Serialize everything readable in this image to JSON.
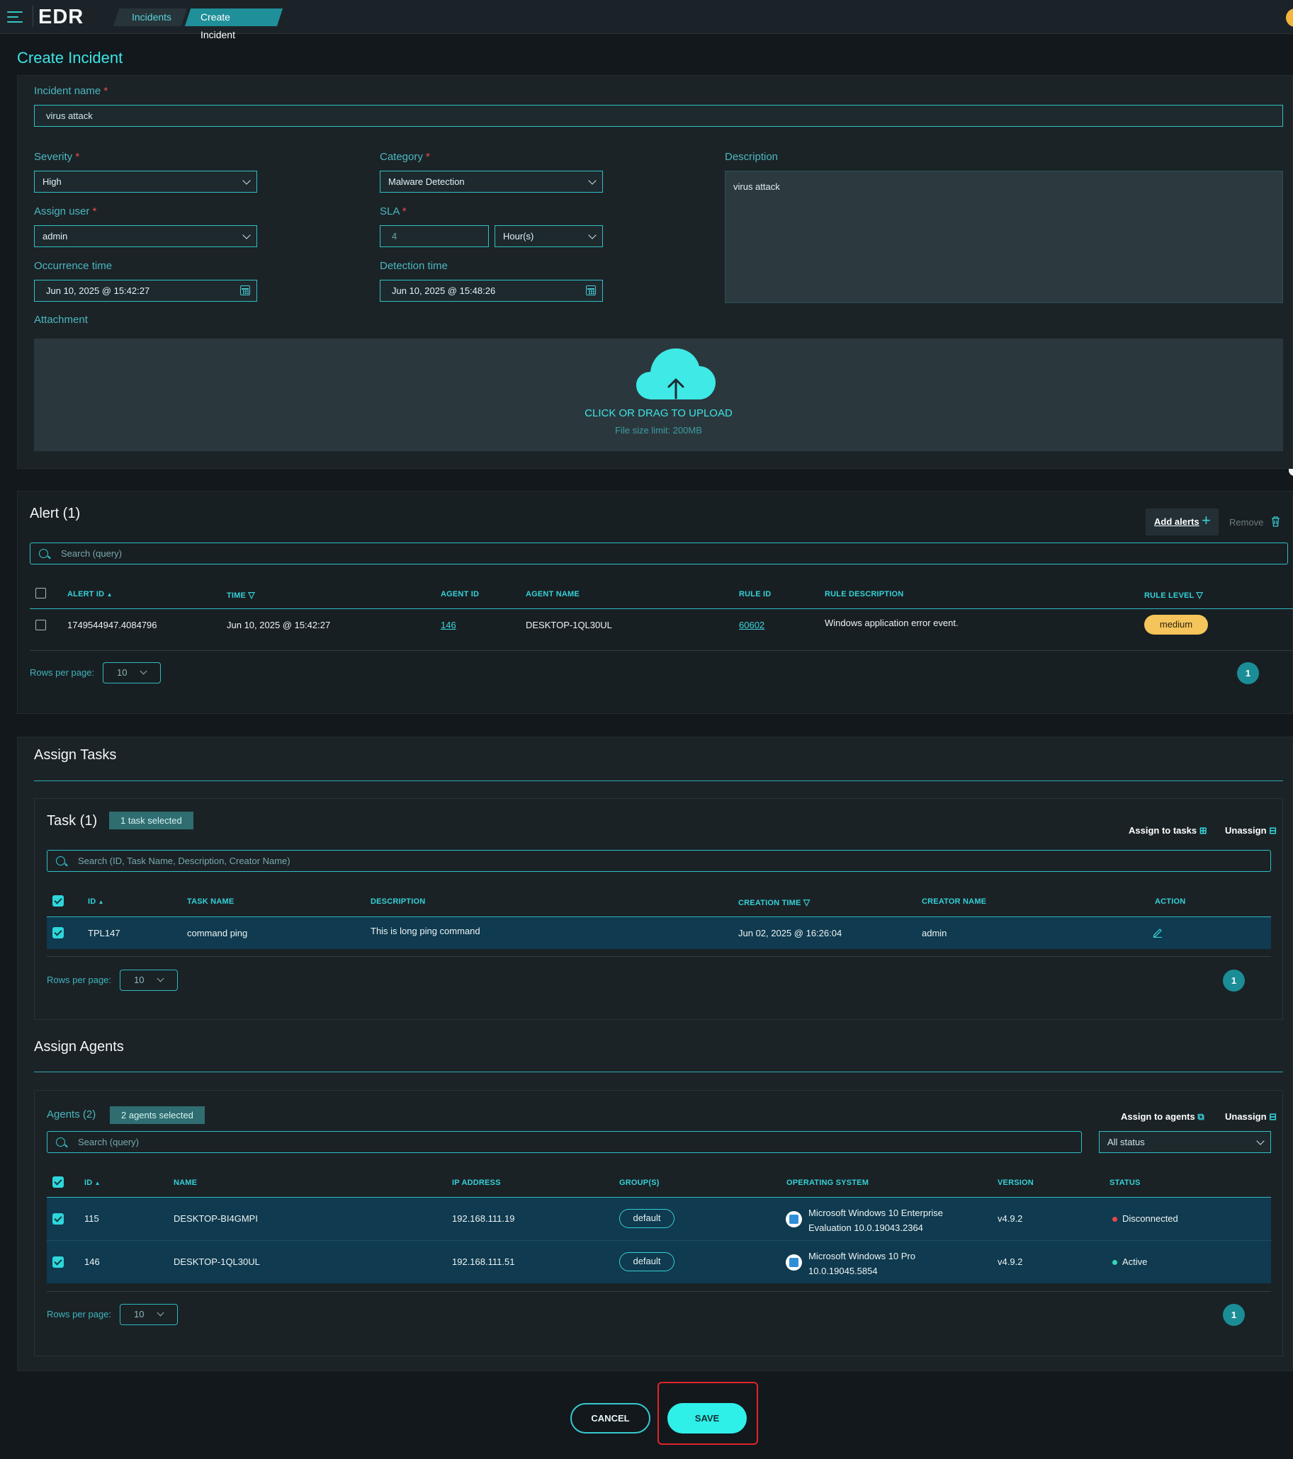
{
  "app": {
    "logo": "EDR"
  },
  "breadcrumb": {
    "items": [
      "Incidents",
      "Create Incident"
    ]
  },
  "page_title": "Create Incident",
  "form": {
    "incident_name": {
      "label": "Incident name",
      "value": "virus attack"
    },
    "severity": {
      "label": "Severity",
      "value": "High"
    },
    "category": {
      "label": "Category",
      "value": "Malware Detection"
    },
    "description": {
      "label": "Description",
      "value": "virus attack"
    },
    "assign_user": {
      "label": "Assign user",
      "value": "admin"
    },
    "sla": {
      "label": "SLA",
      "value": "4",
      "unit": "Hour(s)"
    },
    "occurrence_time": {
      "label": "Occurrence time",
      "value": "Jun 10, 2025 @ 15:42:27"
    },
    "detection_time": {
      "label": "Detection time",
      "value": "Jun 10, 2025 @ 15:48:26"
    },
    "attachment": {
      "label": "Attachment",
      "upload_text": "CLICK OR DRAG TO UPLOAD",
      "limit_text": "File size limit: 200MB"
    },
    "required_mark": "*"
  },
  "alerts": {
    "title": "Alert (1)",
    "add_label": "Add alerts",
    "remove_label": "Remove",
    "search_placeholder": "Search (query)",
    "columns": [
      "ALERT ID",
      "TIME",
      "AGENT ID",
      "AGENT NAME",
      "RULE ID",
      "RULE DESCRIPTION",
      "RULE LEVEL"
    ],
    "rows": [
      {
        "alert_id": "1749544947.4084796",
        "time": "Jun 10, 2025 @ 15:42:27",
        "agent_id": "146",
        "agent_name": "DESKTOP-1QL30UL",
        "rule_id": "60602",
        "rule_description": "Windows application error event.",
        "rule_level": "medium"
      }
    ],
    "rows_per_page_label": "Rows per page:",
    "rows_per_page": "10",
    "page": "1"
  },
  "assign_tasks": {
    "title": "Assign Tasks",
    "task_title": "Task (1)",
    "selected_badge": "1 task selected",
    "assign_label": "Assign to tasks",
    "unassign_label": "Unassign",
    "search_placeholder": "Search (ID, Task Name, Description, Creator Name)",
    "columns": [
      "ID",
      "TASK NAME",
      "DESCRIPTION",
      "CREATION TIME",
      "CREATOR NAME",
      "ACTION"
    ],
    "rows": [
      {
        "id": "TPL147",
        "task_name": "command ping",
        "description": "This is long ping command",
        "creation_time": "Jun 02, 2025 @ 16:26:04",
        "creator_name": "admin"
      }
    ],
    "rows_per_page_label": "Rows per page:",
    "rows_per_page": "10",
    "page": "1"
  },
  "assign_agents": {
    "title": "Assign Agents",
    "agents_title": "Agents (2)",
    "selected_badge": "2 agents selected",
    "assign_label": "Assign to agents",
    "unassign_label": "Unassign",
    "search_placeholder": "Search (query)",
    "status_filter": "All status",
    "columns": [
      "ID",
      "NAME",
      "IP ADDRESS",
      "GROUP(S)",
      "OPERATING SYSTEM",
      "VERSION",
      "STATUS"
    ],
    "rows": [
      {
        "id": "115",
        "name": "DESKTOP-BI4GMPI",
        "ip": "192.168.111.19",
        "group": "default",
        "os_line1": "Microsoft Windows 10 Enterprise",
        "os_line2": "Evaluation 10.0.19043.2364",
        "version": "v4.9.2",
        "status": "Disconnected",
        "status_color": "#e5484d"
      },
      {
        "id": "146",
        "name": "DESKTOP-1QL30UL",
        "ip": "192.168.111.51",
        "group": "default",
        "os_line1": "Microsoft Windows 10 Pro",
        "os_line2": "10.0.19045.5854",
        "version": "v4.9.2",
        "status": "Active",
        "status_color": "#35d6b6"
      }
    ],
    "rows_per_page_label": "Rows per page:",
    "rows_per_page": "10",
    "page": "1"
  },
  "actions": {
    "cancel_label": "CANCEL",
    "save_label": "SAVE"
  },
  "colors": {
    "accent": "#3ee4e4",
    "highlight_box": "#e0252b",
    "medium_badge": "#f5c45a"
  }
}
